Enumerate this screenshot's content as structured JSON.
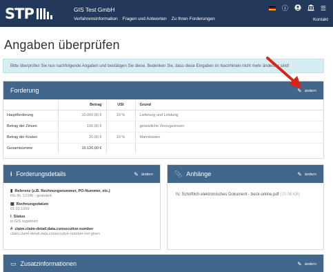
{
  "header": {
    "logo_text": "STP",
    "company": "GIS Test GmbH",
    "nav": [
      "Verfahrensinformation",
      "Fragen und Antworten",
      "Zu Ihren Forderungen"
    ],
    "kontakt": "Kontakt",
    "icons": [
      "german-flag-icon",
      "help-icon",
      "user-icon",
      "bank-icon",
      "menu-icon"
    ]
  },
  "page": {
    "title": "Angaben überprüfen",
    "info_text": "Bitte überprüfen Sie nun nachfolgende Angaben und bestätigen Sie diese. Bedenken Sie, dass diese Eingaben im Nachhinein nicht mehr änderbar sind!"
  },
  "forderung": {
    "title": "Forderung",
    "edit_label": "ändern",
    "columns": [
      "",
      "Betrag",
      "USt",
      "Grund"
    ],
    "rows": [
      {
        "label": "Hauptforderung",
        "betrag": "10.000,00 €",
        "ust": "19 %",
        "grund": "Lieferung und Leistung"
      },
      {
        "label": "Betrag der Zinsen",
        "betrag": "100,00 €",
        "ust": "",
        "grund": "gesetzliche Verzugszinsen"
      },
      {
        "label": "Betrag der Kosten",
        "betrag": "20,00 €",
        "ust": "19 %",
        "grund": "Mahnkosten"
      }
    ],
    "sum_label": "Gesamtsumme",
    "sum_value": "10.120,00 €"
  },
  "details": {
    "title": "Forderungsdetails",
    "edit_label": "ändern",
    "items": [
      {
        "label": "Referenz (z.B. Rechnungsnummer, PO-Nummer, etc.)",
        "value": "RE-Nr. 12345 - geändert",
        "icon": "document-icon"
      },
      {
        "label": "Rechnungsdatum",
        "value": "01.01.1999",
        "icon": "calendar-icon"
      },
      {
        "label": "Status",
        "value": "in GIS registriert",
        "icon": "info-icon"
      },
      {
        "label": "claim.claim-detail.data.consecutive-number",
        "value": "claim.claim-detail.data.consecutive-number-not-given",
        "icon": "hash-icon"
      }
    ]
  },
  "anhaenge": {
    "title": "Anhänge",
    "edit_label": "ändern",
    "item_text": "IV. Schriftlich elektronisches Dokument - beck-online.pdf",
    "item_size": "(70.08 KB)"
  },
  "zusatz": {
    "title": "Zusatzinformationen",
    "edit_label": "ändern"
  },
  "colors": {
    "topbar": "#23395b",
    "panel_header": "#41678c",
    "info_bg": "#d6eef2",
    "annotation_arrow": "#d9241c"
  }
}
